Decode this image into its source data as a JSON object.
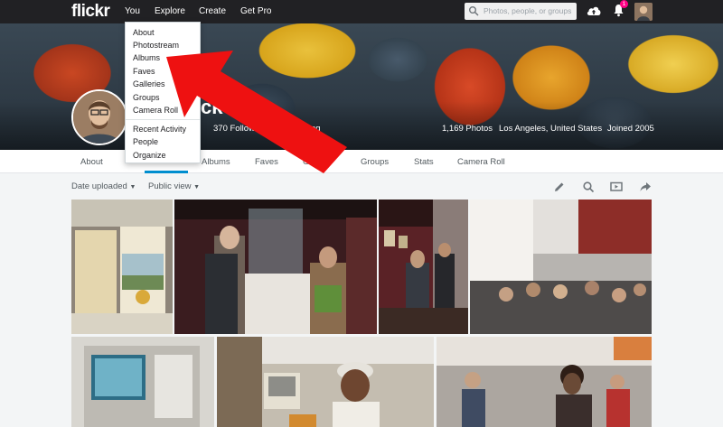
{
  "topnav": {
    "logo": "flickr",
    "links": [
      "You",
      "Explore",
      "Create",
      "Get Pro"
    ],
    "search_placeholder": "Photos, people, or groups",
    "notification_count": "1"
  },
  "dropdown": {
    "items": [
      "About",
      "Photostream",
      "Albums",
      "Faves",
      "Galleries",
      "Groups",
      "Camera Roll"
    ],
    "items2": [
      "Recent Activity",
      "People",
      "Organize"
    ]
  },
  "profile": {
    "name_fragment": "ck",
    "followers": "370 Followers",
    "following_fragment": "ng",
    "photos": "1,169 Photos",
    "location": "Los Angeles, United States",
    "joined": "Joined 2005"
  },
  "tabs": {
    "about": "About",
    "albums": "Albums",
    "faves": "Faves",
    "galleries_fragment": "Ga",
    "groups": "Groups",
    "stats": "Stats",
    "camera_roll": "Camera Roll"
  },
  "toolbar": {
    "sort": "Date uploaded",
    "view": "Public view"
  },
  "icons": [
    "search-icon",
    "upload-icon",
    "bell-icon",
    "pencil-icon",
    "magnifier-icon",
    "slideshow-icon",
    "share-icon",
    "chevron-down-icon"
  ],
  "colors": {
    "topbar": "#212124",
    "accent": "#008ecf",
    "notification": "#ff0084",
    "arrow": "#ee1111"
  }
}
